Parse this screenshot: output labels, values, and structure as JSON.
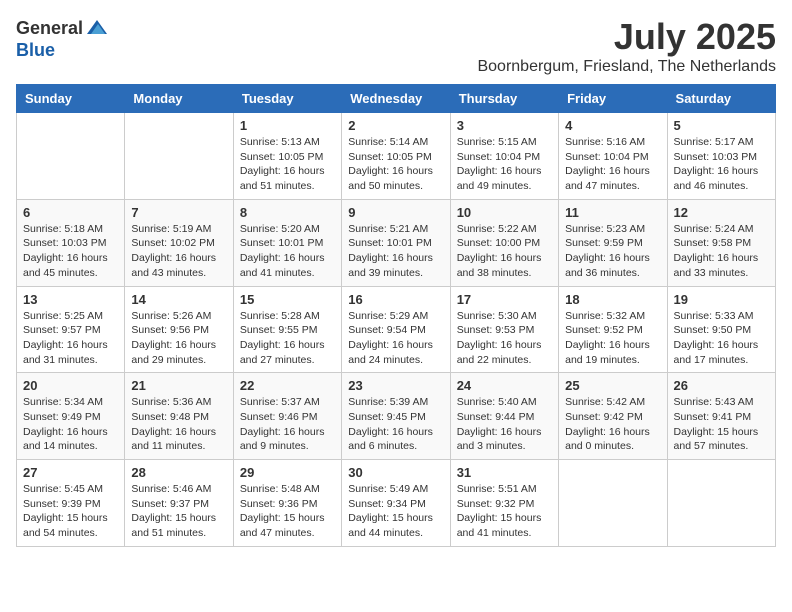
{
  "header": {
    "logo_general": "General",
    "logo_blue": "Blue",
    "month_year": "July 2025",
    "location": "Boornbergum, Friesland, The Netherlands"
  },
  "days_of_week": [
    "Sunday",
    "Monday",
    "Tuesday",
    "Wednesday",
    "Thursday",
    "Friday",
    "Saturday"
  ],
  "weeks": [
    [
      {
        "day": "",
        "info": ""
      },
      {
        "day": "",
        "info": ""
      },
      {
        "day": "1",
        "info": "Sunrise: 5:13 AM\nSunset: 10:05 PM\nDaylight: 16 hours and 51 minutes."
      },
      {
        "day": "2",
        "info": "Sunrise: 5:14 AM\nSunset: 10:05 PM\nDaylight: 16 hours and 50 minutes."
      },
      {
        "day": "3",
        "info": "Sunrise: 5:15 AM\nSunset: 10:04 PM\nDaylight: 16 hours and 49 minutes."
      },
      {
        "day": "4",
        "info": "Sunrise: 5:16 AM\nSunset: 10:04 PM\nDaylight: 16 hours and 47 minutes."
      },
      {
        "day": "5",
        "info": "Sunrise: 5:17 AM\nSunset: 10:03 PM\nDaylight: 16 hours and 46 minutes."
      }
    ],
    [
      {
        "day": "6",
        "info": "Sunrise: 5:18 AM\nSunset: 10:03 PM\nDaylight: 16 hours and 45 minutes."
      },
      {
        "day": "7",
        "info": "Sunrise: 5:19 AM\nSunset: 10:02 PM\nDaylight: 16 hours and 43 minutes."
      },
      {
        "day": "8",
        "info": "Sunrise: 5:20 AM\nSunset: 10:01 PM\nDaylight: 16 hours and 41 minutes."
      },
      {
        "day": "9",
        "info": "Sunrise: 5:21 AM\nSunset: 10:01 PM\nDaylight: 16 hours and 39 minutes."
      },
      {
        "day": "10",
        "info": "Sunrise: 5:22 AM\nSunset: 10:00 PM\nDaylight: 16 hours and 38 minutes."
      },
      {
        "day": "11",
        "info": "Sunrise: 5:23 AM\nSunset: 9:59 PM\nDaylight: 16 hours and 36 minutes."
      },
      {
        "day": "12",
        "info": "Sunrise: 5:24 AM\nSunset: 9:58 PM\nDaylight: 16 hours and 33 minutes."
      }
    ],
    [
      {
        "day": "13",
        "info": "Sunrise: 5:25 AM\nSunset: 9:57 PM\nDaylight: 16 hours and 31 minutes."
      },
      {
        "day": "14",
        "info": "Sunrise: 5:26 AM\nSunset: 9:56 PM\nDaylight: 16 hours and 29 minutes."
      },
      {
        "day": "15",
        "info": "Sunrise: 5:28 AM\nSunset: 9:55 PM\nDaylight: 16 hours and 27 minutes."
      },
      {
        "day": "16",
        "info": "Sunrise: 5:29 AM\nSunset: 9:54 PM\nDaylight: 16 hours and 24 minutes."
      },
      {
        "day": "17",
        "info": "Sunrise: 5:30 AM\nSunset: 9:53 PM\nDaylight: 16 hours and 22 minutes."
      },
      {
        "day": "18",
        "info": "Sunrise: 5:32 AM\nSunset: 9:52 PM\nDaylight: 16 hours and 19 minutes."
      },
      {
        "day": "19",
        "info": "Sunrise: 5:33 AM\nSunset: 9:50 PM\nDaylight: 16 hours and 17 minutes."
      }
    ],
    [
      {
        "day": "20",
        "info": "Sunrise: 5:34 AM\nSunset: 9:49 PM\nDaylight: 16 hours and 14 minutes."
      },
      {
        "day": "21",
        "info": "Sunrise: 5:36 AM\nSunset: 9:48 PM\nDaylight: 16 hours and 11 minutes."
      },
      {
        "day": "22",
        "info": "Sunrise: 5:37 AM\nSunset: 9:46 PM\nDaylight: 16 hours and 9 minutes."
      },
      {
        "day": "23",
        "info": "Sunrise: 5:39 AM\nSunset: 9:45 PM\nDaylight: 16 hours and 6 minutes."
      },
      {
        "day": "24",
        "info": "Sunrise: 5:40 AM\nSunset: 9:44 PM\nDaylight: 16 hours and 3 minutes."
      },
      {
        "day": "25",
        "info": "Sunrise: 5:42 AM\nSunset: 9:42 PM\nDaylight: 16 hours and 0 minutes."
      },
      {
        "day": "26",
        "info": "Sunrise: 5:43 AM\nSunset: 9:41 PM\nDaylight: 15 hours and 57 minutes."
      }
    ],
    [
      {
        "day": "27",
        "info": "Sunrise: 5:45 AM\nSunset: 9:39 PM\nDaylight: 15 hours and 54 minutes."
      },
      {
        "day": "28",
        "info": "Sunrise: 5:46 AM\nSunset: 9:37 PM\nDaylight: 15 hours and 51 minutes."
      },
      {
        "day": "29",
        "info": "Sunrise: 5:48 AM\nSunset: 9:36 PM\nDaylight: 15 hours and 47 minutes."
      },
      {
        "day": "30",
        "info": "Sunrise: 5:49 AM\nSunset: 9:34 PM\nDaylight: 15 hours and 44 minutes."
      },
      {
        "day": "31",
        "info": "Sunrise: 5:51 AM\nSunset: 9:32 PM\nDaylight: 15 hours and 41 minutes."
      },
      {
        "day": "",
        "info": ""
      },
      {
        "day": "",
        "info": ""
      }
    ]
  ]
}
